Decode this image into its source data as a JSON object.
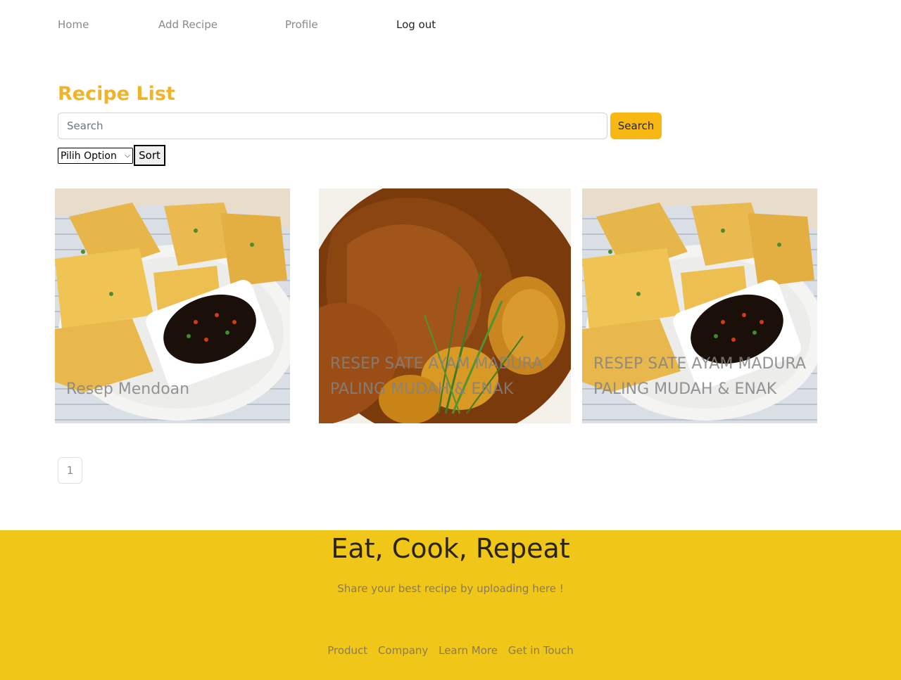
{
  "nav": {
    "home": "Home",
    "add_recipe": "Add Recipe",
    "profile": "Profile",
    "logout": "Log out"
  },
  "page_title": "Recipe List",
  "search": {
    "placeholder": "Search",
    "button_label": "Search"
  },
  "sort": {
    "selected_option": "Pilih Option",
    "button_label": "Sort"
  },
  "recipes": [
    {
      "title": "Resep Mendoan",
      "image": "fried-tempeh-with-soy-sauce-photo"
    },
    {
      "title": "RESEP SATE AYAM MADURA PALING MUDAH & ENAK",
      "image": "braised-chicken-with-potatoes-photo"
    },
    {
      "title": "RESEP SATE AYAM MADURA PALING MUDAH & ENAK",
      "image": "fried-tempeh-with-soy-sauce-photo"
    }
  ],
  "pagination": {
    "current_page": "1"
  },
  "footer": {
    "title": "Eat, Cook, Repeat",
    "subtitle": "Share your best recipe by uploading here !",
    "links": [
      "Product",
      "Company",
      "Learn More",
      "Get in Touch"
    ]
  },
  "colors": {
    "accent": "#f0b429",
    "button": "#f7b814",
    "footer_bg": "#f0c619"
  }
}
